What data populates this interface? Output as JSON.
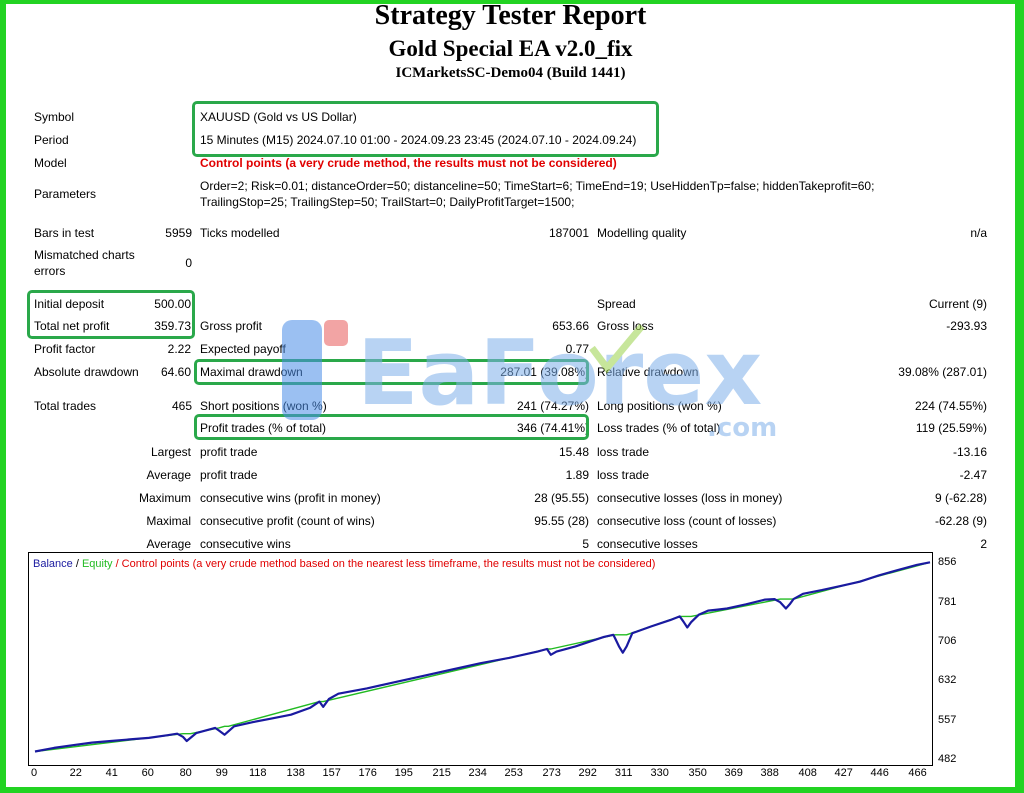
{
  "title": "Strategy Tester Report",
  "ea_name": "Gold Special EA v2.0_fix",
  "server": "ICMarketsSC-Demo04 (Build 1441)",
  "info": {
    "symbol_label": "Symbol",
    "symbol": "XAUUSD (Gold vs US Dollar)",
    "period_label": "Period",
    "period": "15 Minutes (M15) 2024.07.10 01:00 - 2024.09.23 23:45 (2024.07.10 - 2024.09.24)",
    "model_label": "Model",
    "model": "Control points (a very crude method, the results must not be considered)",
    "parameters_label": "Parameters",
    "parameters_line1": "Order=2; Risk=0.01; distanceOrder=50; distanceline=50; TimeStart=6; TimeEnd=19; UseHiddenTp=false; hiddenTakeprofit=60;",
    "parameters_line2": "TrailingStop=25; TrailingStep=50; TrailStart=0; DailyProfitTarget=1500;"
  },
  "bars": {
    "bars_label": "Bars in test",
    "bars": "5959",
    "ticks_label": "Ticks modelled",
    "ticks": "187001",
    "quality_label": "Modelling quality",
    "quality": "n/a",
    "mismatch_label_1": "Mismatched charts",
    "mismatch_label_2": "errors",
    "mismatch": "0"
  },
  "results": {
    "initial_deposit_label": "Initial deposit",
    "initial_deposit": "500.00",
    "spread_label": "Spread",
    "spread": "Current (9)",
    "net_profit_label": "Total net profit",
    "net_profit": "359.73",
    "gross_profit_label": "Gross profit",
    "gross_profit": "653.66",
    "gross_loss_label": "Gross loss",
    "gross_loss": "-293.93",
    "profit_factor_label": "Profit factor",
    "profit_factor": "2.22",
    "expected_payoff_label": "Expected payoff",
    "expected_payoff": "0.77",
    "abs_drawdown_label": "Absolute drawdown",
    "abs_drawdown": "64.60",
    "max_drawdown_label": "Maximal drawdown",
    "max_drawdown": "287.01 (39.08%)",
    "rel_drawdown_label": "Relative drawdown",
    "rel_drawdown": "39.08% (287.01)"
  },
  "trades": {
    "total_label": "Total trades",
    "total": "465",
    "short_label": "Short positions (won %)",
    "short": "241 (74.27%)",
    "long_label": "Long positions (won %)",
    "long": "224 (74.55%)",
    "profit_trades_label": "Profit trades (% of total)",
    "profit_trades": "346 (74.41%)",
    "loss_trades_label": "Loss trades (% of total)",
    "loss_trades": "119 (25.59%)",
    "largest_label": "Largest",
    "largest_profit_label": "profit trade",
    "largest_profit": "15.48",
    "largest_loss_label": "loss trade",
    "largest_loss": "-13.16",
    "average_label": "Average",
    "average_profit_label": "profit trade",
    "average_profit": "1.89",
    "average_loss_label": "loss trade",
    "average_loss": "-2.47",
    "maximum_label": "Maximum",
    "max_wins_label": "consecutive wins (profit in money)",
    "max_wins": "28 (95.55)",
    "max_losses_label": "consecutive losses (loss in money)",
    "max_losses": "9 (-62.28)",
    "maximal_label": "Maximal",
    "maximal_profit_label": "consecutive profit (count of wins)",
    "maximal_profit": "95.55 (28)",
    "maximal_loss_label": "consecutive loss (count of losses)",
    "maximal_loss": "-62.28 (9)",
    "avg_consec_label": "Average",
    "avg_consec_wins_label": "consecutive wins",
    "avg_consec_wins": "5",
    "avg_consec_losses_label": "consecutive losses",
    "avg_consec_losses": "2"
  },
  "watermark": "EaForex",
  "watermark_sub": ".com",
  "chart_legend": {
    "balance": "Balance",
    "sep": " / ",
    "equity": "Equity",
    "control": " / Control points (a very crude method based on the nearest less timeframe, the results must not be considered)"
  },
  "colors": {
    "balance": "#1a1aa0",
    "equity": "#22bb22",
    "control": "#e00000",
    "highlight": "#2aa84a"
  },
  "chart_data": {
    "type": "line",
    "xticks": [
      0,
      22,
      41,
      60,
      80,
      99,
      118,
      138,
      157,
      176,
      195,
      215,
      234,
      253,
      273,
      292,
      311,
      330,
      350,
      369,
      388,
      408,
      427,
      446,
      466
    ],
    "yticks": [
      482,
      557,
      632,
      706,
      781,
      856
    ],
    "ylim": [
      482,
      870
    ],
    "xlim": [
      0,
      472
    ],
    "series": [
      {
        "name": "Balance",
        "x": [
          0,
          10,
          20,
          30,
          40,
          50,
          60,
          70,
          75,
          78,
          80,
          85,
          95,
          97,
          100,
          105,
          115,
          125,
          135,
          145,
          150,
          152,
          155,
          160,
          175,
          190,
          205,
          220,
          235,
          250,
          265,
          270,
          272,
          275,
          285,
          295,
          300,
          305,
          306,
          308,
          310,
          312,
          315,
          325,
          335,
          340,
          342,
          344,
          346,
          350,
          355,
          360,
          365,
          375,
          385,
          390,
          393,
          396,
          398,
          400,
          405,
          415,
          425,
          435,
          445,
          455,
          465,
          472
        ],
        "y": [
          500,
          507,
          512,
          517,
          520,
          523,
          526,
          531,
          534,
          528,
          520,
          535,
          545,
          540,
          532,
          548,
          556,
          563,
          570,
          583,
          595,
          585,
          600,
          610,
          620,
          632,
          644,
          656,
          668,
          678,
          690,
          695,
          684,
          690,
          700,
          712,
          718,
          722,
          715,
          700,
          688,
          700,
          725,
          738,
          750,
          757,
          747,
          736,
          746,
          760,
          768,
          770,
          772,
          780,
          789,
          790,
          784,
          772,
          780,
          790,
          800,
          807,
          815,
          823,
          835,
          845,
          855,
          860
        ]
      },
      {
        "name": "Equity",
        "x": [
          0,
          78,
          80,
          82,
          97,
          100,
          102,
          150,
          152,
          270,
          272,
          306,
          310,
          312,
          340,
          346,
          393,
          398,
          400,
          472
        ],
        "y": [
          500,
          534,
          534,
          534,
          545,
          548,
          548,
          595,
          595,
          695,
          695,
          722,
          722,
          722,
          757,
          757,
          790,
          790,
          790,
          860
        ]
      }
    ]
  }
}
